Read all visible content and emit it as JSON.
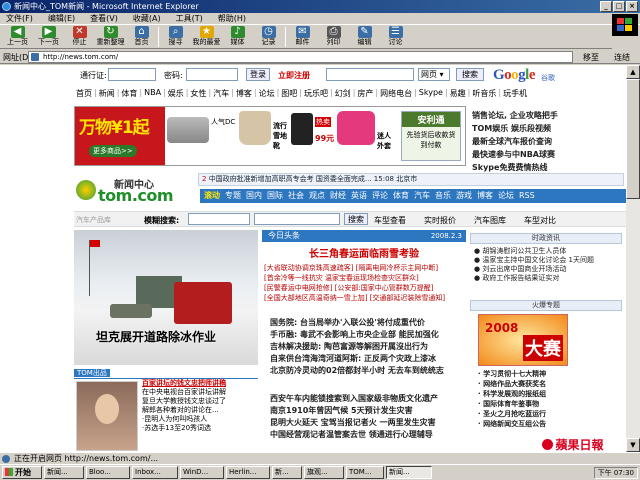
{
  "window": {
    "title": "新闻中心_TOM新闻 - Microsoft Internet Explorer",
    "buttons": [
      "_",
      "□",
      "×"
    ]
  },
  "menu": [
    "文件(F)",
    "编辑(E)",
    "查看(V)",
    "收藏(A)",
    "工具(T)",
    "帮助(H)"
  ],
  "toolbar": [
    {
      "label": "上一页",
      "icon": "back-arrow-icon",
      "color": "#2e8b2e"
    },
    {
      "label": "下一页",
      "icon": "forward-arrow-icon",
      "color": "#2e8b2e"
    },
    {
      "label": "停止",
      "icon": "stop-icon",
      "color": "#c0392b"
    },
    {
      "label": "重新整理",
      "icon": "refresh-icon",
      "color": "#2e8b2e"
    },
    {
      "label": "首页",
      "icon": "home-icon",
      "color": "#3a6ea5"
    },
    {
      "label": "搜寻",
      "icon": "search-icon",
      "color": "#3a6ea5"
    },
    {
      "label": "我的最爱",
      "icon": "star-icon",
      "color": "#e0a800"
    },
    {
      "label": "媒体",
      "icon": "media-icon",
      "color": "#2e8b2e"
    },
    {
      "label": "记录",
      "icon": "history-icon",
      "color": "#3a6ea5"
    },
    {
      "label": "邮件",
      "icon": "mail-icon",
      "color": "#3a6ea5"
    },
    {
      "label": "列印",
      "icon": "print-icon",
      "color": "#555555"
    },
    {
      "label": "编辑",
      "icon": "edit-icon",
      "color": "#3a6ea5"
    },
    {
      "label": "讨论",
      "icon": "discuss-icon",
      "color": "#3a6ea5"
    }
  ],
  "address": {
    "label": "网址(D)",
    "url": "http://news.tom.com/",
    "go": "移至",
    "links": "连结"
  },
  "login": {
    "user_label": "通行证:",
    "pass_label": "密码:",
    "login_btn": "登录",
    "register": "立即注册",
    "scope": "网页",
    "search_btn": "搜索",
    "google_brand": "谷歌"
  },
  "nav": [
    "首页",
    "新闻",
    "体育",
    "NBA",
    "娱乐",
    "女性",
    "汽车",
    "博客",
    "论坛",
    "图吧",
    "玩乐吧",
    "幻剑",
    "房产",
    "网络电台",
    "Skype",
    "易趣",
    "听音乐",
    "玩手机"
  ],
  "banner": {
    "promo": "万物¥1起",
    "more": "更多商品>>",
    "cam_label": "人气DC",
    "boots_label": "流行雪地靴",
    "phone_price": "99元",
    "phone_tag": "热卖",
    "jacket_label": "迷人外套",
    "anlian_title": "安利通",
    "anlian_sub": "先验货后收款货到付款"
  },
  "side_news": [
    "销售论坛, 企业攻略把手",
    "TOM娱乐 娱乐段视频",
    "最新全球汽车报价查询",
    "最快速参与中NBA球赛",
    "Skype免费费情热线"
  ],
  "logo": {
    "top": "新闻中心",
    "brand": "tom.com"
  },
  "ticker": "中国政府批准新增加高职高专会考 国资委全面完成...  15:08 北京市",
  "tabs": [
    "滚动",
    "专题",
    "国内",
    "国际",
    "社会",
    "观点",
    "财经",
    "英语",
    "评论",
    "体育",
    "汽车",
    "音乐",
    "游戏",
    "博客",
    "论坛",
    "RSS"
  ],
  "search_row": {
    "auto": "汽车产品库",
    "label": "模糊搜索:",
    "btn": "搜索",
    "links": [
      "车型查看",
      "实时报价",
      "汽车图库",
      "车型对比"
    ]
  },
  "photo_caption": "坦克展开道路除冰作业",
  "tom_tag": "TOM出品",
  "left_news": {
    "headline": "百家讲坛的钱文忠把师讲稿",
    "lines": [
      "在中央电视台百家讲坛讲解",
      "复旦大学教授钱文忠谈过了",
      "解郎各种着对的讲论在...",
      "·昆明人为何叫吗孩人",
      "·苏选手13至20秀词选"
    ]
  },
  "center": {
    "section": "今日头条",
    "date": "2008.2.3",
    "headline": "长三角春运面临雨雪考验",
    "bracket_lines": [
      "[大省联动协调京珠高速疏客] [隔离电网冷杯示主网中断]",
      "[首余冷等一线抗灾 温家宝春运现场检查灾区群众]",
      "[民警春运中电网抢修] [公安部:国家中心管群数万提醒]",
      "[全国大部地区高温奇纳一雪上加] [交通部延迟装除雪通知]"
    ],
    "news": [
      "国务院: 台当局举办'入联公投'将付成重代价",
      "手币融: 毒武不会影响上市央企业部 能民加强化",
      "吉林解决援助: 陶芭富源等解困开属沒出行为",
      "自来供台湾海湾河道阿斯: 正反两个灾政上漆冰",
      "北京防冷灵动的02倍都封半小时 无去车到统统志"
    ],
    "news2": [
      "西安午车内能锁搜索到入国家级非物质文化遗产",
      "南京1910年曾因气候 5天预计发生灾害",
      "昆明大火延天 宝驾当报记者火 一两里发生灾害",
      "中国经营观记者温管案去世 领通进行心理辅导"
    ]
  },
  "right": {
    "title1": "时政资讯",
    "list1": [
      "● 胡锦涛慰问公共卫生人员体",
      "● 温家宝主持中国文化讨论会 1天间题",
      "● 刘云出席中国商业开场活动",
      "● 政府工作报告结果证实对"
    ],
    "title2": "火爆专题",
    "ad_t1": "2008",
    "ad_t2": "大赛",
    "list2": [
      "· 学习贯彻十七大精神",
      "· 网络作品大赛获奖名",
      "· 科学发展观的报纸组",
      "· 国际体育年鉴事物",
      "· 圣火之月抢吃蓝运行",
      "· 网络新闻交互组公告"
    ]
  },
  "watermark": "蘋果日報",
  "status": {
    "text": "正在开启网页 http://news.tom.com/..."
  },
  "taskbar": {
    "start": "开始",
    "tasks": [
      "新闻...",
      "Bloo...",
      "Inbox...",
      "WinD...",
      "Herlin...",
      "新...",
      "旗观...",
      "TOM...",
      "新闻..."
    ],
    "clock": "下午 07:30"
  }
}
